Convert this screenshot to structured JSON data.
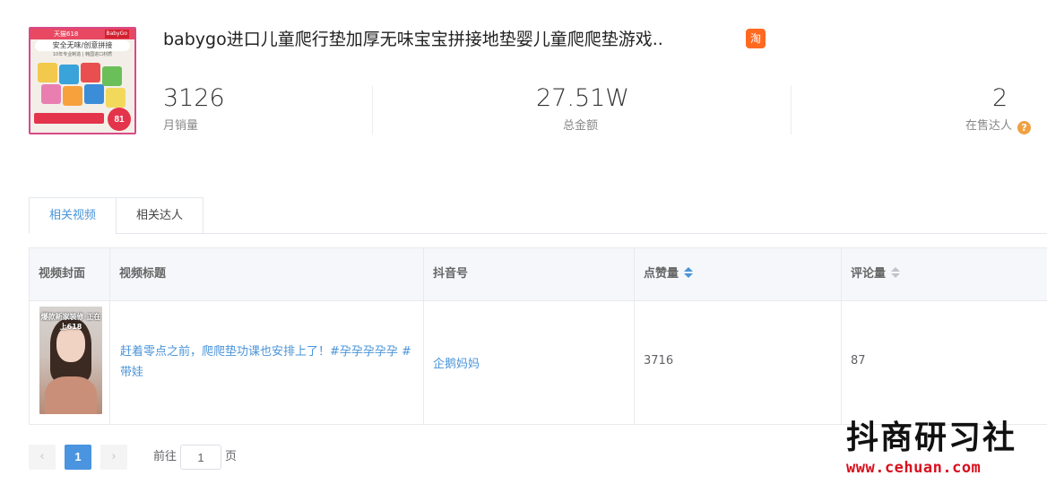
{
  "product": {
    "title": "babygo进口儿童爬行垫加厚无味宝宝拼接地垫婴儿童爬爬垫游戏..",
    "platform_icon": "淘",
    "image": {
      "badge": "天猫618",
      "brand": "BabyGo",
      "headline": "安全无味/创意拼接",
      "subline": "10年专业制造 | 韩国进口材质",
      "price": "81"
    }
  },
  "stats": {
    "monthly_sales": {
      "value": "3126",
      "label": "月销量"
    },
    "total_amount": {
      "value": "27.51W",
      "label": "总金额"
    },
    "active_creators": {
      "value": "2",
      "label": "在售达人"
    }
  },
  "tabs": [
    {
      "label": "相关视频",
      "active": true
    },
    {
      "label": "相关达人",
      "active": false
    }
  ],
  "table": {
    "headers": {
      "cover": "视频封面",
      "title": "视频标题",
      "douyin_id": "抖音号",
      "likes": "点赞量",
      "comments": "评论量"
    },
    "rows": [
      {
        "cover_caption": "爆款新家装修 正在上618",
        "title": "赶着零点之前，爬爬垫功课也安排上了！#孕孕孕孕孕 #带娃",
        "douyin_id": "企鹅妈妈",
        "likes": "3716",
        "comments": "87"
      }
    ]
  },
  "pagination": {
    "current_page": "1",
    "goto_prefix": "前往",
    "goto_value": "1",
    "goto_suffix": "页"
  },
  "watermark": {
    "name": "抖商研习社",
    "url": "www.cehuan.com"
  },
  "colors": {
    "accent": "#4a94d8",
    "platform_icon": "#ff6a20",
    "help_icon": "#f0a040",
    "watermark_url": "#d8101e"
  }
}
